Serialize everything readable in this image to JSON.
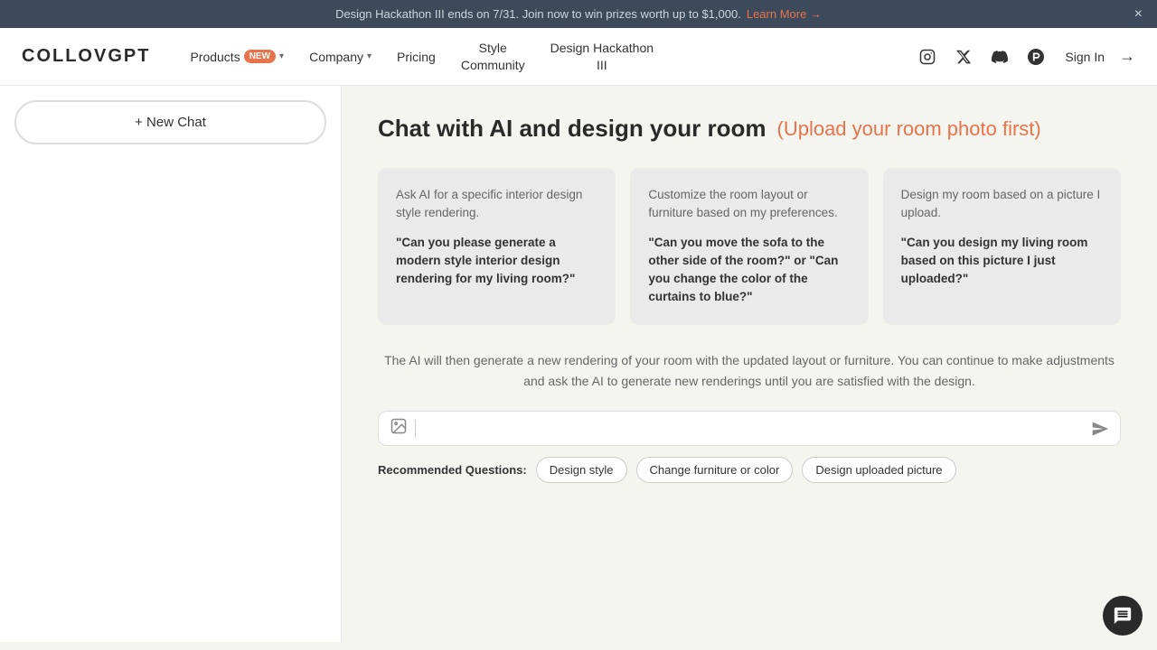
{
  "banner": {
    "text": "Design Hackathon III ends on 7/31. Join now to win prizes worth up to $1,000.",
    "link_text": "Learn More →",
    "close_label": "×"
  },
  "nav": {
    "logo": "COLLOVGPT",
    "items": [
      {
        "id": "products",
        "label": "Products",
        "has_chevron": true,
        "badge": "NEW"
      },
      {
        "id": "company",
        "label": "Company",
        "has_chevron": true
      },
      {
        "id": "pricing",
        "label": "Pricing"
      },
      {
        "id": "style-community",
        "label": "Style\nCommunity",
        "multiline": true
      },
      {
        "id": "design-hackathon",
        "label": "Design Hackathon\nIII",
        "multiline": true
      }
    ],
    "sign_in": "Sign In"
  },
  "sidebar": {
    "new_chat_label": "+ New Chat"
  },
  "main": {
    "title": "Chat with AI and design your room",
    "upload_hint": "(Upload your room photo first)",
    "cards": [
      {
        "description": "Ask AI for a specific interior design style rendering.",
        "example": "\"Can you please generate a modern style interior design rendering for my living room?\""
      },
      {
        "description": "Customize the room layout or furniture based on my preferences.",
        "example": "\"Can you move the sofa to the other side of the room?\" or \"Can you change the color of the curtains to blue?\""
      },
      {
        "description": "Design my room based on a picture I upload.",
        "example": "\"Can you design my living room based on this picture I just uploaded?\""
      }
    ],
    "ai_description": "The AI will then generate a new rendering of your room with the updated layout or furniture. You can continue to make\nadjustments and ask the AI to generate new renderings until you are satisfied with the design.",
    "chat_placeholder": "",
    "recommended_label": "Recommended Questions:",
    "recommended_chips": [
      {
        "id": "design-style",
        "label": "Design style"
      },
      {
        "id": "change-furniture",
        "label": "Change furniture or color"
      },
      {
        "id": "design-uploaded",
        "label": "Design uploaded picture"
      }
    ]
  }
}
